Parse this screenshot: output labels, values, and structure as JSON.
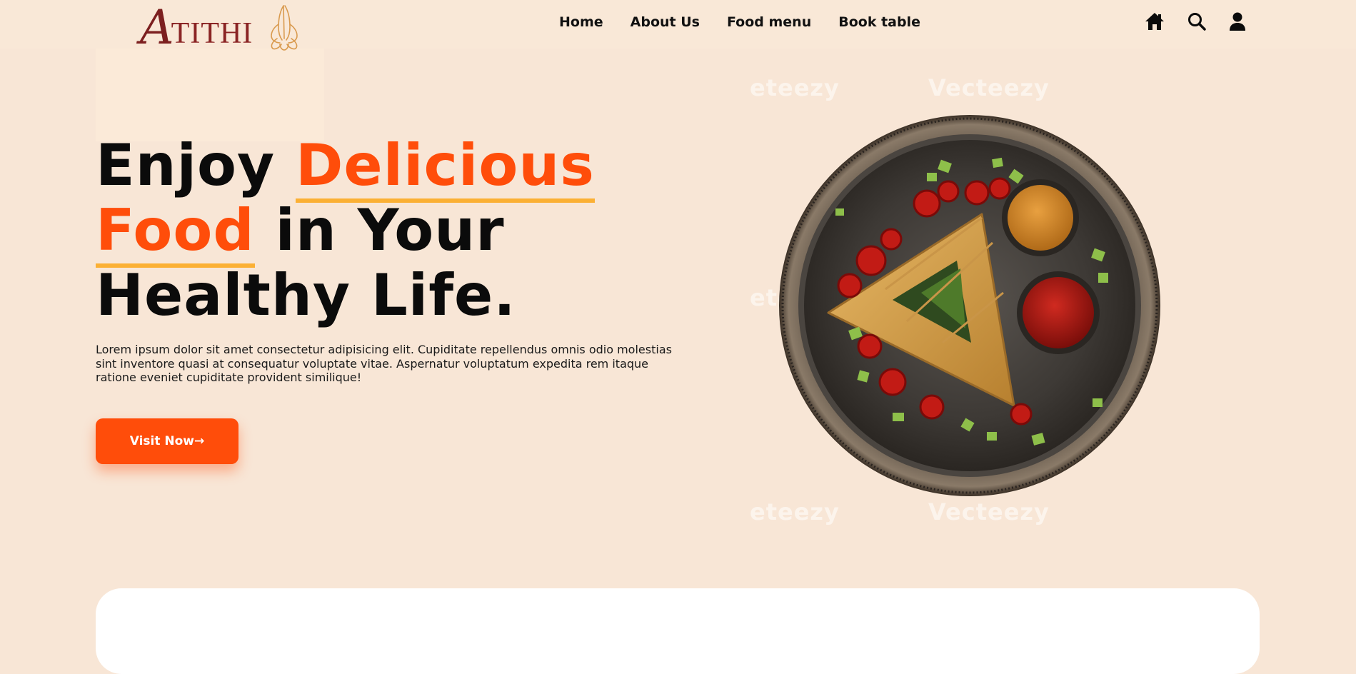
{
  "brand": {
    "initial": "A",
    "name": "TITHI",
    "colors": {
      "maroon": "#7c1f1f",
      "gold": "#d99a4e"
    }
  },
  "nav": {
    "items": [
      {
        "label": "Home"
      },
      {
        "label": "About Us"
      },
      {
        "label": "Food menu"
      },
      {
        "label": "Book table"
      }
    ],
    "icons": [
      "home-icon",
      "search-icon",
      "user-icon"
    ]
  },
  "hero": {
    "title": {
      "word1": "Enjoy",
      "highlight1": "Delicious",
      "highlight2": "Food",
      "word2": "in Your",
      "line3": "Healthy Life."
    },
    "description": "Lorem ipsum dolor sit amet consectetur adipisicing elit. Cupiditate repellendus omnis odio molestias sint inventore quasi at consequatur voluptate vitae. Aspernatur voluptatum expedita rem itaque ratione eveniet cupiditate provident similique!",
    "button_label": "Visit Now→",
    "image_alt": "samosa-plate"
  },
  "watermark": {
    "text": "Vecteezy",
    "partial": "eteezy"
  },
  "colors": {
    "accent": "#ff4d0a",
    "underline": "#fbb034",
    "background": "#f8e6d6",
    "header_bg": "#f9e8d7",
    "card": "#ffffff"
  }
}
